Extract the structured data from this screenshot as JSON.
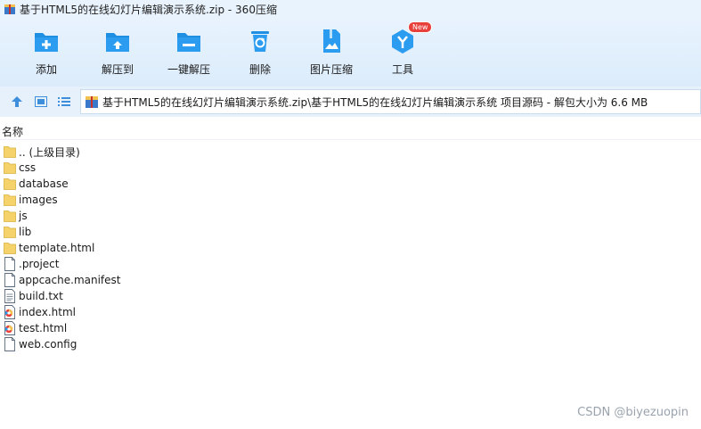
{
  "window": {
    "title": "基于HTML5的在线幻灯片编辑演示系统.zip - 360压缩",
    "app_icon": "archive-icon"
  },
  "toolbar": {
    "items": [
      {
        "label": "添加",
        "icon": "add-file-icon"
      },
      {
        "label": "解压到",
        "icon": "extract-to-icon"
      },
      {
        "label": "一键解压",
        "icon": "one-click-extract-icon"
      },
      {
        "label": "删除",
        "icon": "recycle-bin-icon"
      },
      {
        "label": "图片压缩",
        "icon": "image-compress-icon"
      },
      {
        "label": "工具",
        "icon": "tools-icon",
        "badge": "New"
      }
    ]
  },
  "address": {
    "path": "基于HTML5的在线幻灯片编辑演示系统.zip\\基于HTML5的在线幻灯片编辑演示系统 项目源码 - 解包大小为 6.6 MB"
  },
  "columns": {
    "name": "名称"
  },
  "files": [
    {
      "name": ".. (上级目录)",
      "type": "folder"
    },
    {
      "name": "css",
      "type": "folder"
    },
    {
      "name": "database",
      "type": "folder"
    },
    {
      "name": "images",
      "type": "folder"
    },
    {
      "name": "js",
      "type": "folder"
    },
    {
      "name": "lib",
      "type": "folder"
    },
    {
      "name": "template.html",
      "type": "folder"
    },
    {
      "name": ".project",
      "type": "file"
    },
    {
      "name": "appcache.manifest",
      "type": "file"
    },
    {
      "name": "build.txt",
      "type": "text"
    },
    {
      "name": "index.html",
      "type": "html"
    },
    {
      "name": "test.html",
      "type": "html"
    },
    {
      "name": "web.config",
      "type": "file"
    }
  ],
  "watermark": "CSDN @biyezuopin",
  "colors": {
    "accent": "#1e8fe1",
    "toolbar_bg": "#e0eefc",
    "folder": "#f5d36a",
    "badge": "#e8403b"
  }
}
